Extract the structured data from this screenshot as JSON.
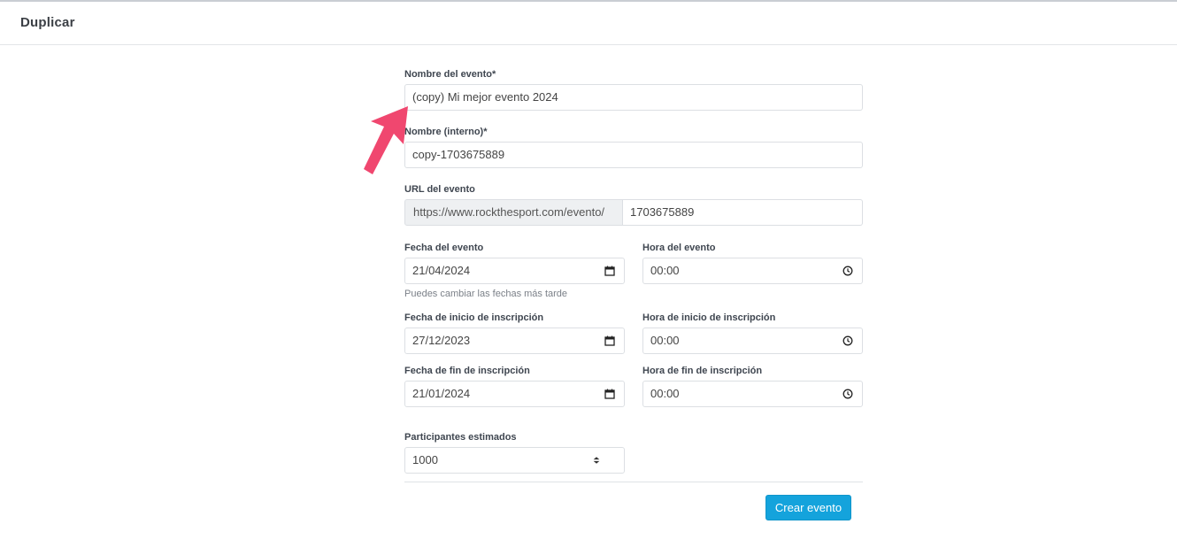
{
  "header": {
    "title": "Duplicar"
  },
  "form": {
    "event_name": {
      "label": "Nombre del evento*",
      "value": "(copy) Mi mejor evento 2024"
    },
    "internal_name": {
      "label": "Nombre (interno)*",
      "value": "copy-1703675889"
    },
    "event_url": {
      "label": "URL del evento",
      "prefix": "https://www.rockthesport.com/evento/",
      "value": "1703675889"
    },
    "event_date": {
      "label": "Fecha del evento",
      "value": "21/04/2024",
      "help": "Puedes cambiar las fechas más tarde"
    },
    "event_time": {
      "label": "Hora del evento",
      "value": "00:00"
    },
    "registration_start_date": {
      "label": "Fecha de inicio de inscripción",
      "value": "27/12/2023"
    },
    "registration_start_time": {
      "label": "Hora de inicio de inscripción",
      "value": "00:00"
    },
    "registration_end_date": {
      "label": "Fecha de fin de inscripción",
      "value": "21/01/2024"
    },
    "registration_end_time": {
      "label": "Hora de fin de inscripción",
      "value": "00:00"
    },
    "participants": {
      "label": "Participantes estimados",
      "value": "1000"
    },
    "submit_label": "Crear evento"
  },
  "icons": {
    "calendar": "calendar-icon",
    "clock": "clock-icon",
    "spinner": "number-spinner-icon",
    "pointer": "pointer-arrow-icon"
  },
  "colors": {
    "primary_button": "#14a3dc",
    "pointer_arrow": "#f0476f",
    "addon_bg": "#eef0f2"
  }
}
